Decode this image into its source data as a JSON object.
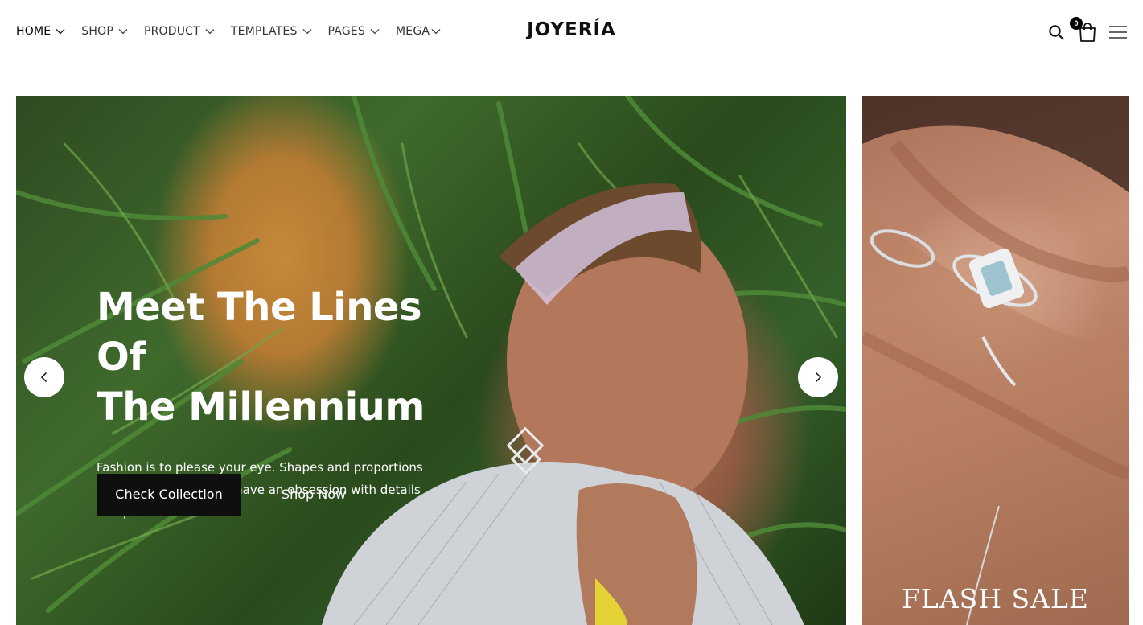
{
  "header": {
    "nav": [
      {
        "label": "HOME"
      },
      {
        "label": "SHOP"
      },
      {
        "label": "PRODUCT"
      },
      {
        "label": "TEMPLATES"
      },
      {
        "label": "PAGES"
      },
      {
        "label": "MEGA"
      }
    ],
    "logo": "JOYERÍA",
    "cart_count": "0",
    "icons": {
      "search": "search-icon",
      "cart": "shopping-bag-icon",
      "menu": "hamburger-menu-icon"
    }
  },
  "hero": {
    "title_line1": "Meet The Lines Of",
    "title_line2": "The Millennium",
    "description": "Fashion is to please your eye. Shapes and proportions are for your intellect. I have an obsession with details and pattern.",
    "primary_button": "Check Collection",
    "secondary_button": "Shop Now",
    "prev_icon": "chevron-left-icon",
    "next_icon": "chevron-right-icon"
  },
  "promo": {
    "label": "FLASH SALE"
  },
  "colors": {
    "text": "#111111",
    "button_bg": "#0f0f0f",
    "accent_white": "#ffffff"
  }
}
